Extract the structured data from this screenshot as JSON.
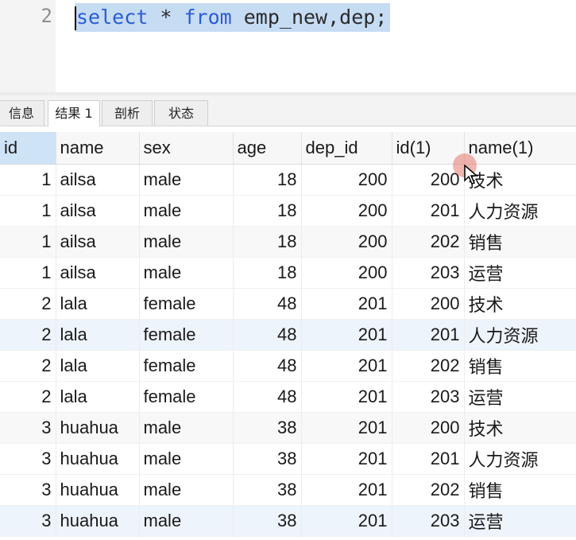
{
  "editor": {
    "line_number": "2",
    "code_kw1": "select",
    "code_mid": " * ",
    "code_kw2": "from",
    "code_rest": " emp_new,dep;"
  },
  "tabs": [
    {
      "label": "信息"
    },
    {
      "label": "结果 1",
      "active": true
    },
    {
      "label": "剖析"
    },
    {
      "label": "状态"
    }
  ],
  "table": {
    "columns": [
      "id",
      "name",
      "sex",
      "age",
      "dep_id",
      "id(1)",
      "name(1)"
    ],
    "rows": [
      [
        "1",
        "ailsa",
        "male",
        "18",
        "200",
        "200",
        "技术"
      ],
      [
        "1",
        "ailsa",
        "male",
        "18",
        "200",
        "201",
        "人力资源"
      ],
      [
        "1",
        "ailsa",
        "male",
        "18",
        "200",
        "202",
        "销售"
      ],
      [
        "1",
        "ailsa",
        "male",
        "18",
        "200",
        "203",
        "运营"
      ],
      [
        "2",
        "lala",
        "female",
        "48",
        "201",
        "200",
        "技术"
      ],
      [
        "2",
        "lala",
        "female",
        "48",
        "201",
        "201",
        "人力资源"
      ],
      [
        "2",
        "lala",
        "female",
        "48",
        "201",
        "202",
        "销售"
      ],
      [
        "2",
        "lala",
        "female",
        "48",
        "201",
        "203",
        "运营"
      ],
      [
        "3",
        "huahua",
        "male",
        "38",
        "201",
        "200",
        "技术"
      ],
      [
        "3",
        "huahua",
        "male",
        "38",
        "201",
        "201",
        "人力资源"
      ],
      [
        "3",
        "huahua",
        "male",
        "38",
        "201",
        "202",
        "销售"
      ],
      [
        "3",
        "huahua",
        "male",
        "38",
        "201",
        "203",
        "运营"
      ]
    ]
  },
  "colors": {
    "selection": "#c6dcf3",
    "keyword": "#2a5bd7"
  }
}
